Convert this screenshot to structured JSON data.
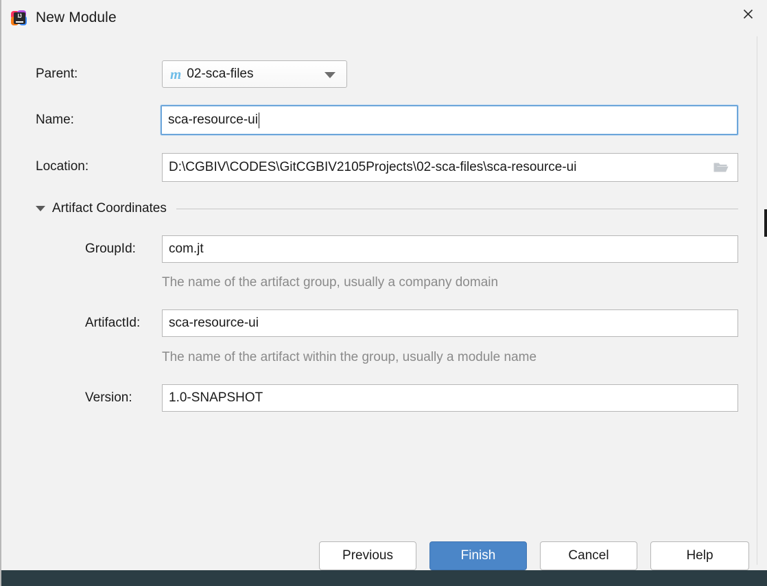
{
  "window": {
    "title": "New Module",
    "app_icon": "intellij-idea-icon",
    "close_label": "✕"
  },
  "form": {
    "parent": {
      "label": "Parent:",
      "value": "02-sca-files",
      "icon": "maven-m-icon",
      "icon_letter": "m",
      "arrow": "chevron-down-icon"
    },
    "name": {
      "label": "Name:",
      "value": "sca-resource-ui",
      "focused": true
    },
    "location": {
      "label": "Location:",
      "value": "D:\\CGBIV\\CODES\\GitCGBIV2105Projects\\02-sca-files\\sca-resource-ui",
      "browse_icon": "folder-icon"
    }
  },
  "artifact_section": {
    "title": "Artifact Coordinates",
    "expanded": true,
    "toggle_icon": "triangle-down-icon",
    "fields": [
      {
        "label": "GroupId:",
        "value": "com.jt",
        "hint": "The name of the artifact group, usually a company domain"
      },
      {
        "label": "ArtifactId:",
        "value": "sca-resource-ui",
        "hint": "The name of the artifact within the group, usually a module name"
      },
      {
        "label": "Version:",
        "value": "1.0-SNAPSHOT",
        "hint": ""
      }
    ]
  },
  "buttons": {
    "previous": "Previous",
    "finish": "Finish",
    "cancel": "Cancel",
    "help": "Help"
  },
  "colors": {
    "primary": "#4b86c8",
    "dialog_bg": "#f2f2f2",
    "field_bg": "#ffffff",
    "focus_border": "#6ca6da",
    "hint_text": "#8a8a8a",
    "maven_icon": "#6fbde8",
    "bottom_strip": "#2b3d44"
  }
}
